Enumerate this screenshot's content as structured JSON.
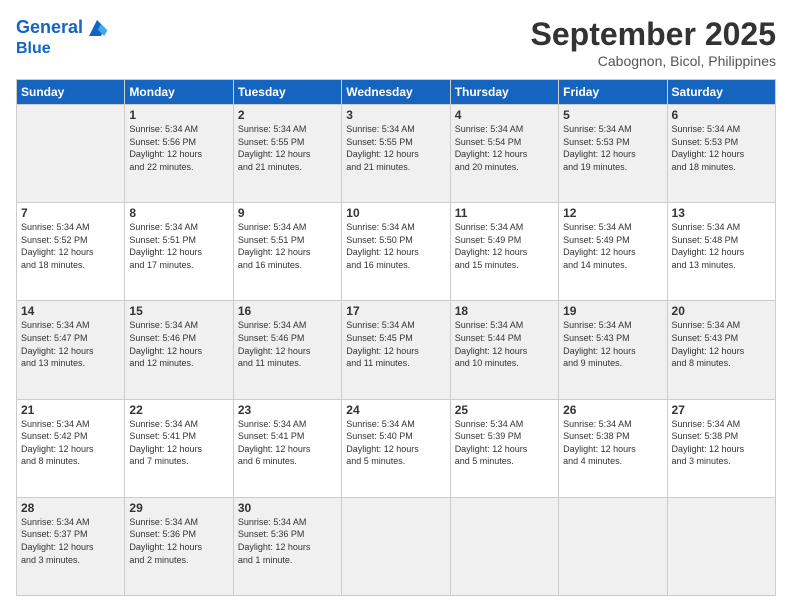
{
  "header": {
    "logo_line1": "General",
    "logo_line2": "Blue",
    "month": "September 2025",
    "location": "Cabognon, Bicol, Philippines"
  },
  "days_of_week": [
    "Sunday",
    "Monday",
    "Tuesday",
    "Wednesday",
    "Thursday",
    "Friday",
    "Saturday"
  ],
  "weeks": [
    [
      {
        "day": "",
        "info": ""
      },
      {
        "day": "1",
        "info": "Sunrise: 5:34 AM\nSunset: 5:56 PM\nDaylight: 12 hours\nand 22 minutes."
      },
      {
        "day": "2",
        "info": "Sunrise: 5:34 AM\nSunset: 5:55 PM\nDaylight: 12 hours\nand 21 minutes."
      },
      {
        "day": "3",
        "info": "Sunrise: 5:34 AM\nSunset: 5:55 PM\nDaylight: 12 hours\nand 21 minutes."
      },
      {
        "day": "4",
        "info": "Sunrise: 5:34 AM\nSunset: 5:54 PM\nDaylight: 12 hours\nand 20 minutes."
      },
      {
        "day": "5",
        "info": "Sunrise: 5:34 AM\nSunset: 5:53 PM\nDaylight: 12 hours\nand 19 minutes."
      },
      {
        "day": "6",
        "info": "Sunrise: 5:34 AM\nSunset: 5:53 PM\nDaylight: 12 hours\nand 18 minutes."
      }
    ],
    [
      {
        "day": "7",
        "info": "Sunrise: 5:34 AM\nSunset: 5:52 PM\nDaylight: 12 hours\nand 18 minutes."
      },
      {
        "day": "8",
        "info": "Sunrise: 5:34 AM\nSunset: 5:51 PM\nDaylight: 12 hours\nand 17 minutes."
      },
      {
        "day": "9",
        "info": "Sunrise: 5:34 AM\nSunset: 5:51 PM\nDaylight: 12 hours\nand 16 minutes."
      },
      {
        "day": "10",
        "info": "Sunrise: 5:34 AM\nSunset: 5:50 PM\nDaylight: 12 hours\nand 16 minutes."
      },
      {
        "day": "11",
        "info": "Sunrise: 5:34 AM\nSunset: 5:49 PM\nDaylight: 12 hours\nand 15 minutes."
      },
      {
        "day": "12",
        "info": "Sunrise: 5:34 AM\nSunset: 5:49 PM\nDaylight: 12 hours\nand 14 minutes."
      },
      {
        "day": "13",
        "info": "Sunrise: 5:34 AM\nSunset: 5:48 PM\nDaylight: 12 hours\nand 13 minutes."
      }
    ],
    [
      {
        "day": "14",
        "info": "Sunrise: 5:34 AM\nSunset: 5:47 PM\nDaylight: 12 hours\nand 13 minutes."
      },
      {
        "day": "15",
        "info": "Sunrise: 5:34 AM\nSunset: 5:46 PM\nDaylight: 12 hours\nand 12 minutes."
      },
      {
        "day": "16",
        "info": "Sunrise: 5:34 AM\nSunset: 5:46 PM\nDaylight: 12 hours\nand 11 minutes."
      },
      {
        "day": "17",
        "info": "Sunrise: 5:34 AM\nSunset: 5:45 PM\nDaylight: 12 hours\nand 11 minutes."
      },
      {
        "day": "18",
        "info": "Sunrise: 5:34 AM\nSunset: 5:44 PM\nDaylight: 12 hours\nand 10 minutes."
      },
      {
        "day": "19",
        "info": "Sunrise: 5:34 AM\nSunset: 5:43 PM\nDaylight: 12 hours\nand 9 minutes."
      },
      {
        "day": "20",
        "info": "Sunrise: 5:34 AM\nSunset: 5:43 PM\nDaylight: 12 hours\nand 8 minutes."
      }
    ],
    [
      {
        "day": "21",
        "info": "Sunrise: 5:34 AM\nSunset: 5:42 PM\nDaylight: 12 hours\nand 8 minutes."
      },
      {
        "day": "22",
        "info": "Sunrise: 5:34 AM\nSunset: 5:41 PM\nDaylight: 12 hours\nand 7 minutes."
      },
      {
        "day": "23",
        "info": "Sunrise: 5:34 AM\nSunset: 5:41 PM\nDaylight: 12 hours\nand 6 minutes."
      },
      {
        "day": "24",
        "info": "Sunrise: 5:34 AM\nSunset: 5:40 PM\nDaylight: 12 hours\nand 5 minutes."
      },
      {
        "day": "25",
        "info": "Sunrise: 5:34 AM\nSunset: 5:39 PM\nDaylight: 12 hours\nand 5 minutes."
      },
      {
        "day": "26",
        "info": "Sunrise: 5:34 AM\nSunset: 5:38 PM\nDaylight: 12 hours\nand 4 minutes."
      },
      {
        "day": "27",
        "info": "Sunrise: 5:34 AM\nSunset: 5:38 PM\nDaylight: 12 hours\nand 3 minutes."
      }
    ],
    [
      {
        "day": "28",
        "info": "Sunrise: 5:34 AM\nSunset: 5:37 PM\nDaylight: 12 hours\nand 3 minutes."
      },
      {
        "day": "29",
        "info": "Sunrise: 5:34 AM\nSunset: 5:36 PM\nDaylight: 12 hours\nand 2 minutes."
      },
      {
        "day": "30",
        "info": "Sunrise: 5:34 AM\nSunset: 5:36 PM\nDaylight: 12 hours\nand 1 minute."
      },
      {
        "day": "",
        "info": ""
      },
      {
        "day": "",
        "info": ""
      },
      {
        "day": "",
        "info": ""
      },
      {
        "day": "",
        "info": ""
      }
    ]
  ]
}
